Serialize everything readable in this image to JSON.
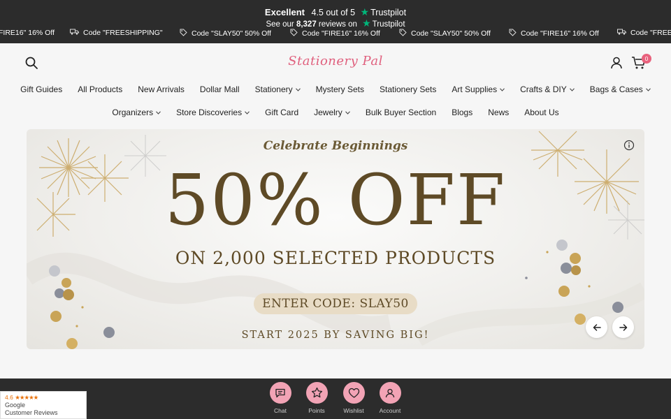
{
  "trustpilot": {
    "rating_word": "Excellent",
    "rating_text": "4.5 out of 5",
    "brand": "Trustpilot",
    "reviews_prefix": "See our",
    "reviews_count": "8,327",
    "reviews_suffix": "reviews on"
  },
  "ticker": [
    {
      "icon": "tag-icon",
      "text": "FIRE16\" 16% Off"
    },
    {
      "icon": "truck-icon",
      "text": "Code \"FREESHIPPING\""
    },
    {
      "icon": "tag-icon",
      "text": "Code \"SLAY50\" 50% Off"
    },
    {
      "icon": "tag-icon",
      "text": "Code \"FIRE16\" 16% Off"
    },
    {
      "icon": "tag-icon",
      "text": "Code \"SLAY50\" 50% Off"
    },
    {
      "icon": "tag-icon",
      "text": "Code \"FIRE16\" 16% Off"
    },
    {
      "icon": "truck-icon",
      "text": "Code \"FREE"
    }
  ],
  "header": {
    "logo": "Stationery Pal",
    "cart_count": "0"
  },
  "nav": {
    "row1": [
      {
        "label": "Gift Guides",
        "dropdown": false
      },
      {
        "label": "All Products",
        "dropdown": false
      },
      {
        "label": "New Arrivals",
        "dropdown": false
      },
      {
        "label": "Dollar Mall",
        "dropdown": false
      },
      {
        "label": "Stationery",
        "dropdown": true
      },
      {
        "label": "Mystery Sets",
        "dropdown": false
      },
      {
        "label": "Stationery Sets",
        "dropdown": false
      },
      {
        "label": "Art Supplies",
        "dropdown": true
      },
      {
        "label": "Crafts & DIY",
        "dropdown": true
      },
      {
        "label": "Bags & Cases",
        "dropdown": true
      }
    ],
    "row2": [
      {
        "label": "Organizers",
        "dropdown": true
      },
      {
        "label": "Store Discoveries",
        "dropdown": true
      },
      {
        "label": "Gift Card",
        "dropdown": false
      },
      {
        "label": "Jewelry",
        "dropdown": true
      },
      {
        "label": "Bulk Buyer Section",
        "dropdown": false
      },
      {
        "label": "Blogs",
        "dropdown": false
      },
      {
        "label": "News",
        "dropdown": false
      },
      {
        "label": "About Us",
        "dropdown": false
      }
    ]
  },
  "banner": {
    "kicker": "Celebrate Beginnings",
    "headline": "50% OFF",
    "subhead": "ON 2,000 SELECTED PRODUCTS",
    "code_text": "ENTER CODE:  SLAY50",
    "footer": "START 2025 BY SAVING BIG!",
    "accent_color": "#5e4a26"
  },
  "dock": [
    {
      "label": "Chat",
      "icon": "chat-icon"
    },
    {
      "label": "Points",
      "icon": "star-icon"
    },
    {
      "label": "Wishlist",
      "icon": "heart-icon"
    },
    {
      "label": "Account",
      "icon": "user-icon"
    }
  ],
  "google": {
    "score": "4.6",
    "stars": "★★★★★",
    "line1": "Google",
    "line2": "Customer Reviews"
  }
}
